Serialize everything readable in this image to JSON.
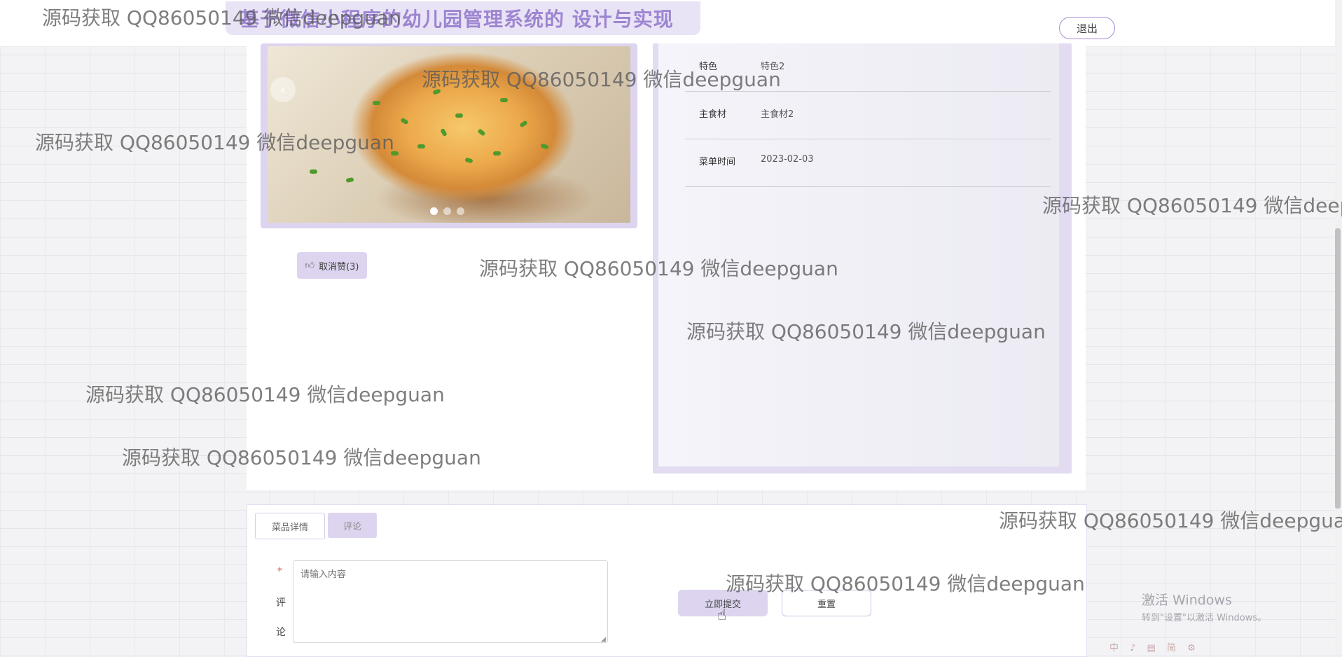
{
  "header": {
    "site_title": "基于微信小程序的幼儿园管理系统的 设计与实现",
    "logout_label": "退出"
  },
  "carousel": {
    "prev_symbol": "‹",
    "slide_count": 3,
    "active_slide": 1
  },
  "like_button": {
    "label": "取消赞(3)",
    "icon": "thumbs-up-icon"
  },
  "details": [
    {
      "label": "特色",
      "value": "特色2"
    },
    {
      "label": "主食材",
      "value": "主食材2"
    },
    {
      "label": "菜单时间",
      "value": "2023-02-03"
    }
  ],
  "tabs": [
    {
      "label": "菜品详情",
      "active": false
    },
    {
      "label": "评论",
      "active": true
    }
  ],
  "comment_form": {
    "required_mark": "*",
    "label_line1": "评",
    "label_line2": "论",
    "placeholder": "请输入内容",
    "submit_label": "立即提交",
    "reset_label": "重置"
  },
  "watermark_text": "源码获取 QQ86050149 微信deepguan",
  "os_overlay": {
    "activate_title": "激活 Windows",
    "activate_sub": "转到\"设置\"以激活 Windows。",
    "tray": "中 ♪ ▤ 简 ⚙"
  },
  "colors": {
    "accent": "#ddd5ef",
    "accent_border": "#a58bd6",
    "title": "#9d85d2"
  }
}
